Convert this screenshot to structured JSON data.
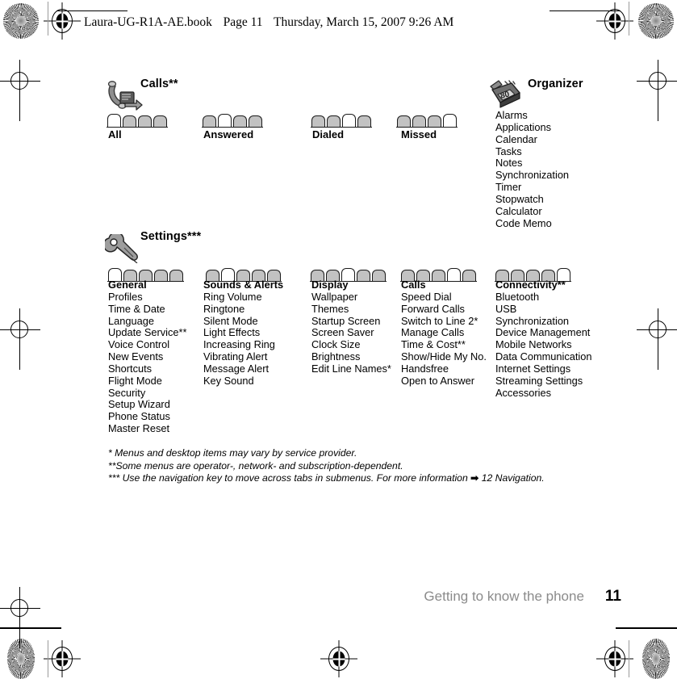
{
  "header": {
    "filename": "Laura-UG-R1A-AE.book",
    "page_label": "Page 11",
    "timestamp": "Thursday, March 15, 2007  9:26 AM"
  },
  "sections": [
    {
      "id": "calls",
      "title": "Calls**",
      "icon": "phone-handset-icon",
      "tab_count": 4,
      "tabs": [
        {
          "label": "All",
          "selected_index": 0
        },
        {
          "label": "Answered",
          "selected_index": 1
        },
        {
          "label": "Dialed",
          "selected_index": 2
        },
        {
          "label": "Missed",
          "selected_index": 3
        }
      ]
    },
    {
      "id": "organizer",
      "title": "Organizer",
      "icon": "alarm-clock-calendar-icon",
      "items": [
        "Alarms",
        "Applications",
        "Calendar",
        "Tasks",
        "Notes",
        "Synchronization",
        "Timer",
        "Stopwatch",
        "Calculator",
        "Code Memo"
      ]
    },
    {
      "id": "settings",
      "title": "Settings***",
      "icon": "wrench-screwdriver-icon",
      "tab_count": 5,
      "columns": [
        {
          "label": "General",
          "selected_index": 0,
          "items": [
            "Profiles",
            "Time & Date",
            "Language",
            "Update Service**",
            "Voice Control",
            "New Events",
            "Shortcuts",
            "Flight Mode",
            "Security",
            "Setup Wizard",
            "Phone Status",
            "Master Reset"
          ]
        },
        {
          "label": "Sounds & Alerts",
          "selected_index": 1,
          "items": [
            "Ring Volume",
            "Ringtone",
            "Silent Mode",
            "Light Effects",
            "Increasing Ring",
            "Vibrating Alert",
            "Message Alert",
            "Key Sound"
          ]
        },
        {
          "label": "Display",
          "selected_index": 2,
          "items": [
            "Wallpaper",
            "Themes",
            "Startup Screen",
            "Screen Saver",
            "Clock Size",
            "Brightness",
            "Edit Line Names*"
          ]
        },
        {
          "label": "Calls",
          "selected_index": 3,
          "items": [
            "Speed Dial",
            "Forward Calls",
            "Switch to Line 2*",
            "Manage Calls",
            "Time & Cost**",
            "Show/Hide My No.",
            "Handsfree",
            "Open to Answer"
          ]
        },
        {
          "label": "Connectivity**",
          "selected_index": 4,
          "items": [
            "Bluetooth",
            "USB",
            "Synchronization",
            "Device Management",
            "Mobile Networks",
            "Data Communication",
            "Internet Settings",
            "Streaming Settings",
            "Accessories"
          ]
        }
      ]
    }
  ],
  "footnotes": {
    "one": "* Menus and desktop items may vary by service provider.",
    "two": "**Some menus are operator-, network- and subscription-dependent.",
    "three_before": "*** Use the navigation key to move across tabs in submenus. For more information ",
    "three_arrow": "➡",
    "three_after": " 12 Navigation."
  },
  "page_footer": {
    "breadcrumb": "Getting to know the phone",
    "page_number": "11"
  }
}
